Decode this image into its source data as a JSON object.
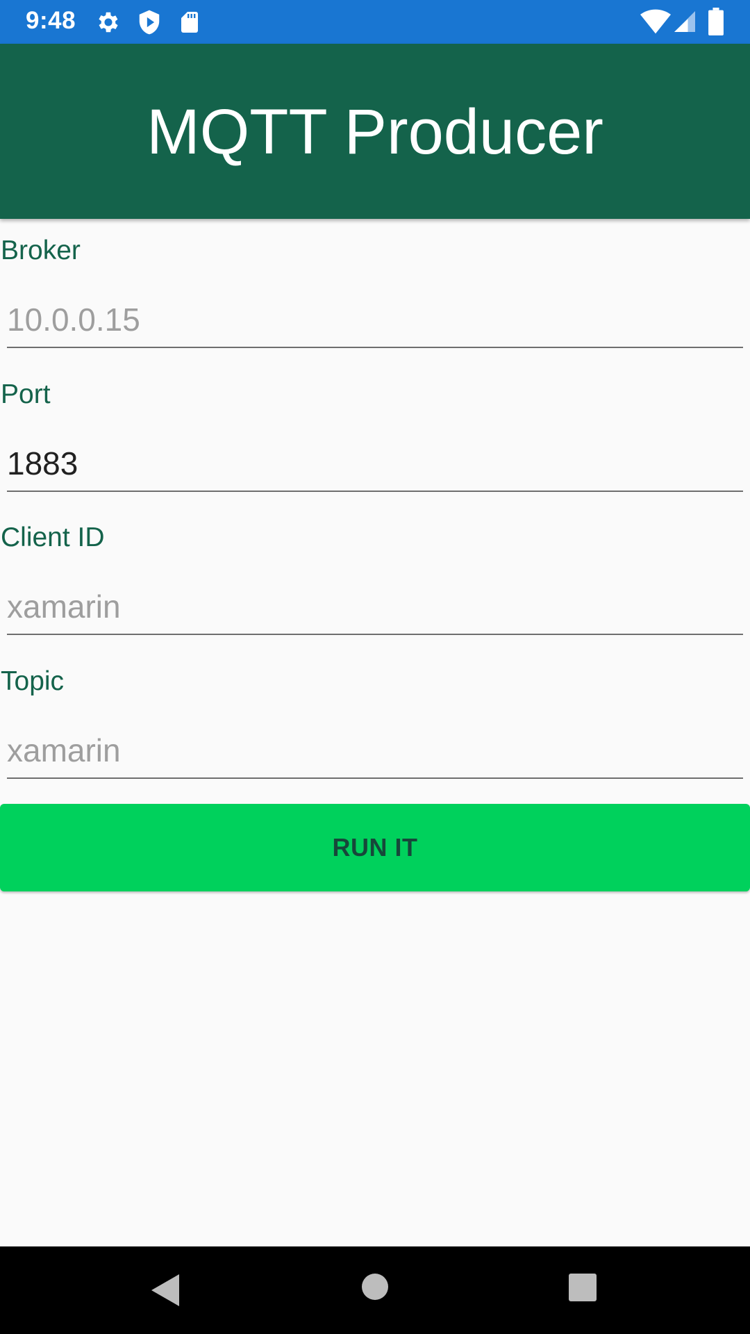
{
  "status_bar": {
    "time": "9:48",
    "icons_left": [
      "gear-icon",
      "shield-play-icon",
      "sd-card-icon"
    ],
    "icons_right": [
      "wifi-icon",
      "cell-signal-icon",
      "battery-icon"
    ],
    "color": "#1976d2"
  },
  "app_bar": {
    "title": "MQTT Producer",
    "color": "#14634b"
  },
  "form": {
    "broker": {
      "label": "Broker",
      "placeholder": "10.0.0.15",
      "value": ""
    },
    "port": {
      "label": "Port",
      "placeholder": "",
      "value": "1883"
    },
    "client_id": {
      "label": "Client ID",
      "placeholder": "xamarin",
      "value": ""
    },
    "topic": {
      "label": "Topic",
      "placeholder": "xamarin",
      "value": ""
    }
  },
  "run_button": {
    "label": "RUN IT",
    "color": "#00d15c"
  },
  "nav_bar": {
    "buttons": [
      "back-icon",
      "home-icon",
      "recents-icon"
    ]
  }
}
